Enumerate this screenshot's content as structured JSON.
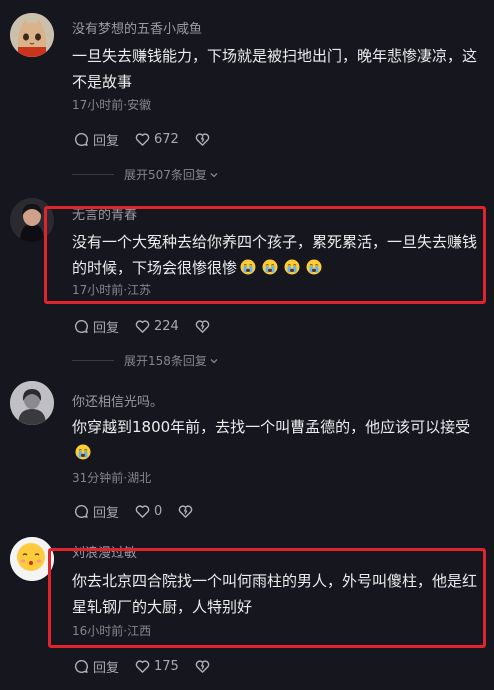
{
  "comments": [
    {
      "username": "没有梦想的五香小咸鱼",
      "text": "一旦失去赚钱能力，下场就是被扫地出门，晚年悲惨凄凉，这不是故事",
      "time_location": "17小时前·安徽",
      "reply_label": "回复",
      "likes": "672",
      "expand_label": "展开507条回复"
    },
    {
      "username": "无言的青春",
      "text": "没有一个大冤种去给你养四个孩子，累死累活，一旦失去赚钱的时候，下场会很惨很惨",
      "emoji": [
        "crying-face",
        "crying-face",
        "crying-face",
        "crying-face"
      ],
      "time_location": "17小时前·江苏",
      "reply_label": "回复",
      "likes": "224",
      "expand_label": "展开158条回复"
    },
    {
      "username": "你还相信光吗。",
      "text": "你穿越到1800年前，去找一个叫曹孟德的，他应该可以接受",
      "emoji": [
        "crying-face"
      ],
      "time_location": "31分钟前·湖北",
      "reply_label": "回复",
      "likes": "0"
    },
    {
      "username": "刘浪漫过敏",
      "text": "你去北京四合院找一个叫何雨柱的男人，外号叫傻柱，他是红星轧钢厂的大厨，人特别好",
      "time_location": "16小时前·江西",
      "reply_label": "回复",
      "likes": "175"
    }
  ],
  "colors": {
    "background": "#16161e",
    "highlight_box": "#e0242e",
    "secondary_text": "#85858d"
  }
}
